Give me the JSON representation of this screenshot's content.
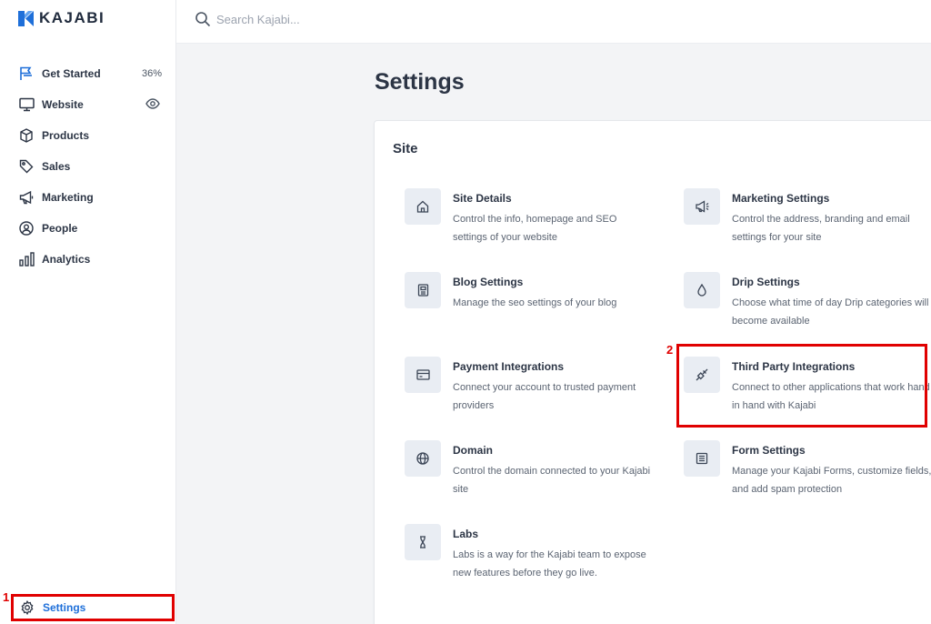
{
  "brand": {
    "name": "KAJABI",
    "accent": "#1e6fd9"
  },
  "search": {
    "placeholder": "Search Kajabi..."
  },
  "sidebar": {
    "items": [
      {
        "label": "Get Started",
        "icon": "flag-icon",
        "badge": "36%"
      },
      {
        "label": "Website",
        "icon": "monitor-icon",
        "extra_icon": "eye-icon"
      },
      {
        "label": "Products",
        "icon": "box-icon"
      },
      {
        "label": "Sales",
        "icon": "tag-icon"
      },
      {
        "label": "Marketing",
        "icon": "megaphone-icon"
      },
      {
        "label": "People",
        "icon": "person-icon"
      },
      {
        "label": "Analytics",
        "icon": "bar-chart-icon"
      }
    ],
    "settings": {
      "label": "Settings",
      "icon": "gear-icon"
    }
  },
  "main": {
    "title": "Settings",
    "section_title": "Site",
    "tiles": [
      {
        "title": "Site Details",
        "desc": "Control the info, homepage and SEO settings of your website",
        "icon": "home-icon"
      },
      {
        "title": "Marketing Settings",
        "desc": "Control the address, branding and email settings for your site",
        "icon": "megaphone-icon"
      },
      {
        "title": "Blog Settings",
        "desc": "Manage the seo settings of your blog",
        "icon": "document-icon"
      },
      {
        "title": "Drip Settings",
        "desc": "Choose what time of day Drip categories will become available",
        "icon": "drop-icon"
      },
      {
        "title": "Payment Integrations",
        "desc": "Connect your account to trusted payment providers",
        "icon": "credit-card-icon"
      },
      {
        "title": "Third Party Integrations",
        "desc": "Connect to other applications that work hand in hand with Kajabi",
        "icon": "plug-icon"
      },
      {
        "title": "Domain",
        "desc": "Control the domain connected to your Kajabi site",
        "icon": "globe-icon"
      },
      {
        "title": "Form Settings",
        "desc": "Manage your Kajabi Forms, customize fields, and add spam protection",
        "icon": "form-icon"
      },
      {
        "title": "Labs",
        "desc": "Labs is a way for the Kajabi team to expose new features before they go live.",
        "icon": "flask-icon"
      }
    ]
  },
  "annotations": {
    "marker_1": "1",
    "marker_2": "2",
    "color": "#e00000"
  }
}
